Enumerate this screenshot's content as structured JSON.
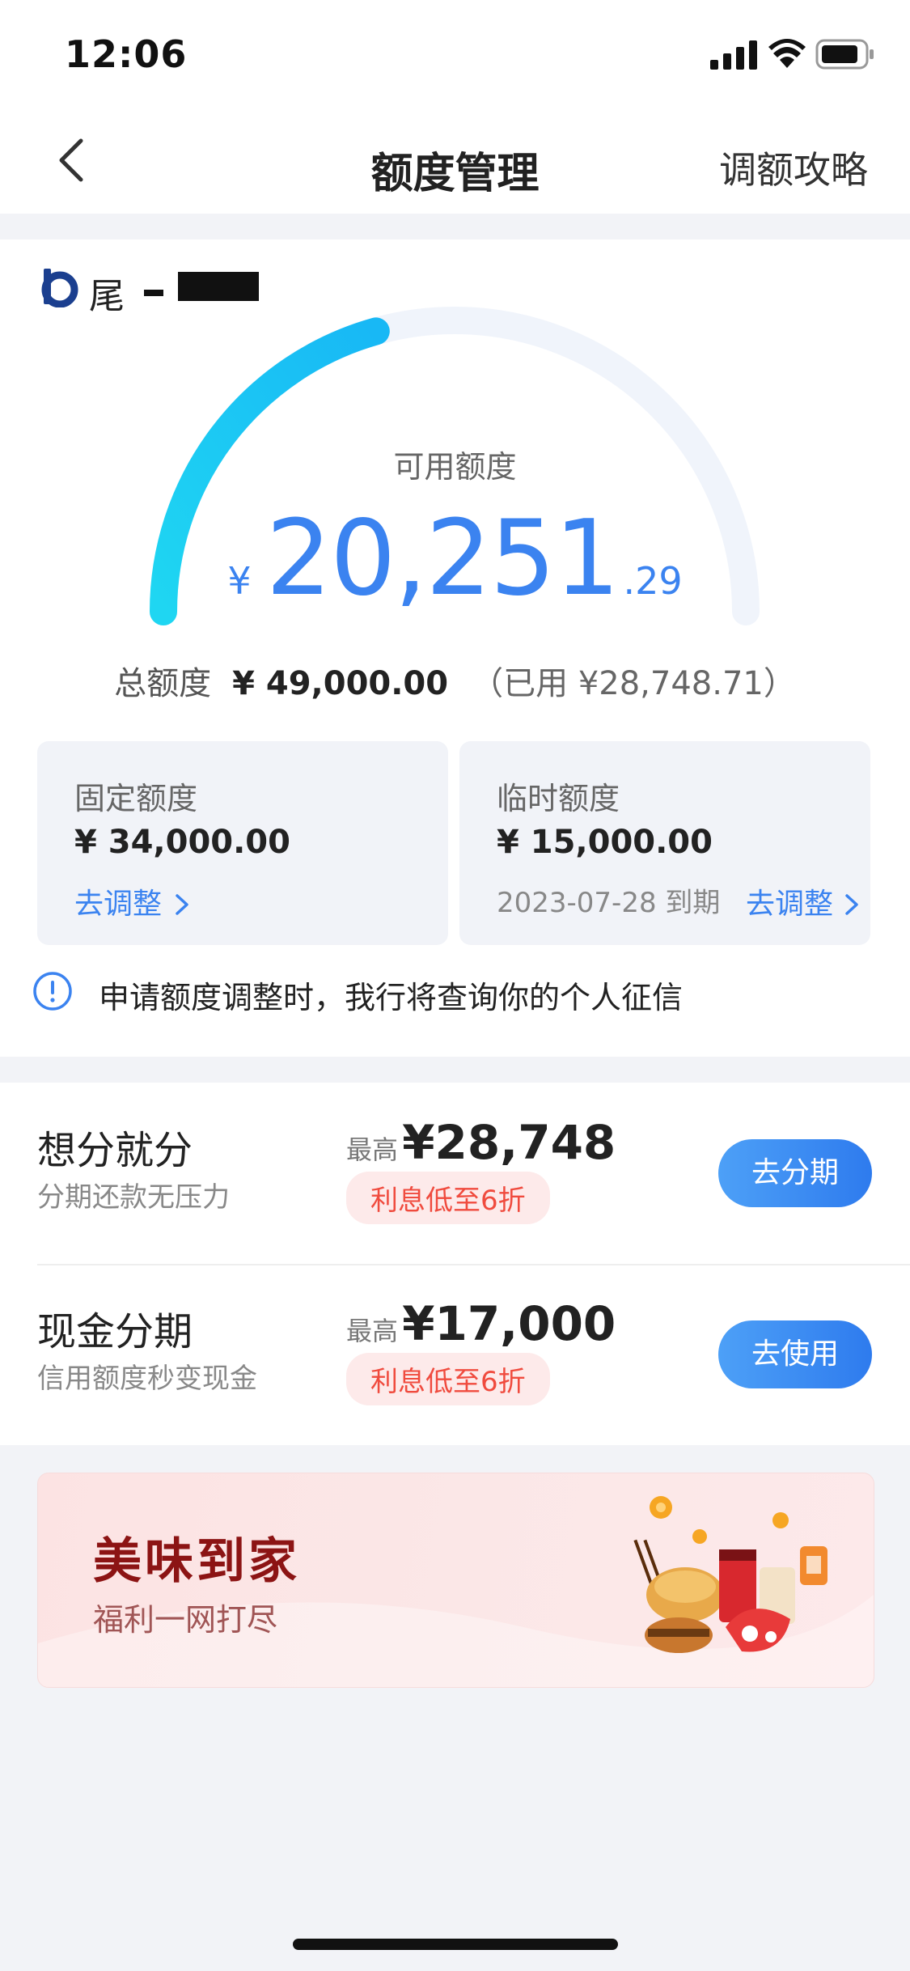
{
  "status_bar": {
    "time": "12:06"
  },
  "nav": {
    "title": "额度管理",
    "right_link": "调额攻略"
  },
  "card": {
    "name_prefix": "尾"
  },
  "credit": {
    "available_label": "可用额度",
    "currency": "¥",
    "available_int": "20,251",
    "available_dec": ".29",
    "total_label": "总额度",
    "total_value": "¥ 49,000.00",
    "used_text": "（已用 ¥28,748.71）",
    "used_fraction": 0.587
  },
  "fixed_quota": {
    "title": "固定额度",
    "value": "¥ 34,000.00",
    "link": "去调整"
  },
  "temp_quota": {
    "title": "临时额度",
    "value": "¥ 15,000.00",
    "expiry": "2023-07-28 到期",
    "link": "去调整"
  },
  "notice": {
    "text": "申请额度调整时，我行将查询你的个人征信"
  },
  "installments": [
    {
      "title": "想分就分",
      "subtitle": "分期还款无压力",
      "max_label": "最高",
      "max_value": "¥28,748",
      "tag": "利息低至6折",
      "button": "去分期"
    },
    {
      "title": "现金分期",
      "subtitle": "信用额度秒变现金",
      "max_label": "最高",
      "max_value": "¥17,000",
      "tag": "利息低至6折",
      "button": "去使用"
    }
  ],
  "banner": {
    "title": "美味到家",
    "subtitle": "福利一网打尽"
  },
  "colors": {
    "accent": "#3b83f0",
    "gauge_start": "#1fd6f2",
    "gauge_end": "#18b8f5",
    "tag_red": "#f04b3e"
  }
}
